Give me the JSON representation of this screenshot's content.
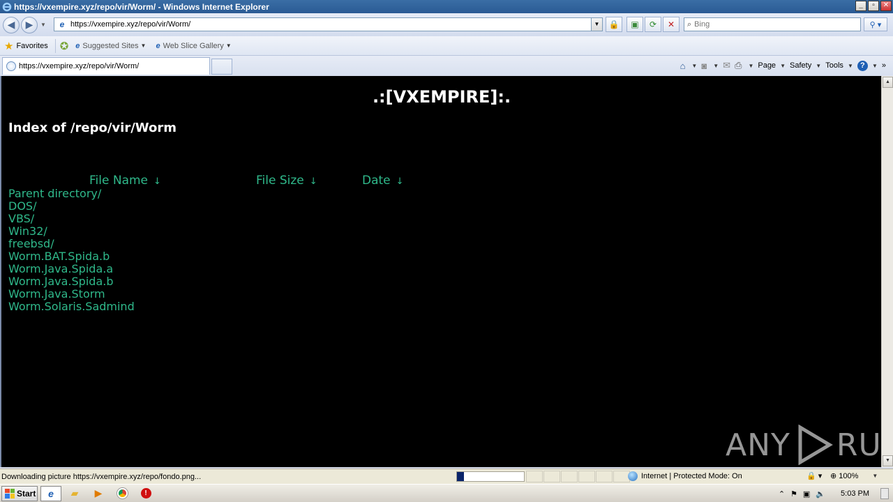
{
  "window": {
    "title": "https://vxempire.xyz/repo/vir/Worm/ - Windows Internet Explorer",
    "controls": {
      "minimize": "_",
      "maximize": "▫",
      "close": "✕"
    }
  },
  "address_bar": {
    "url": "https://vxempire.xyz/repo/vir/Worm/"
  },
  "search": {
    "placeholder": "Bing"
  },
  "favorites_bar": {
    "favorites_label": "Favorites",
    "suggested_sites": "Suggested Sites",
    "web_slice_gallery": "Web Slice Gallery"
  },
  "tab": {
    "label": "https://vxempire.xyz/repo/vir/Worm/"
  },
  "command_bar": {
    "page": "Page",
    "safety": "Safety",
    "tools": "Tools",
    "help": "?"
  },
  "page": {
    "site_title": ".:[VXEMPIRE]:.",
    "heading": "Index of /repo/vir/Worm",
    "columns": {
      "name": "File Name",
      "size": "File Size",
      "date": "Date",
      "sort_arrow": "↓"
    },
    "entries": [
      "Parent directory/",
      "DOS/",
      "VBS/",
      "Win32/",
      "freebsd/",
      "Worm.BAT.Spida.b",
      "Worm.Java.Spida.a",
      "Worm.Java.Spida.b",
      "Worm.Java.Storm",
      "Worm.Solaris.Sadmind"
    ]
  },
  "watermark": {
    "left": "ANY",
    "right": "RUN"
  },
  "status_bar": {
    "text": "Downloading picture https://vxempire.xyz/repo/fondo.png...",
    "progress": 0.1,
    "zone": "Internet | Protected Mode: On",
    "zoom": "100%"
  },
  "taskbar": {
    "start": "Start",
    "clock": "5:03 PM"
  }
}
